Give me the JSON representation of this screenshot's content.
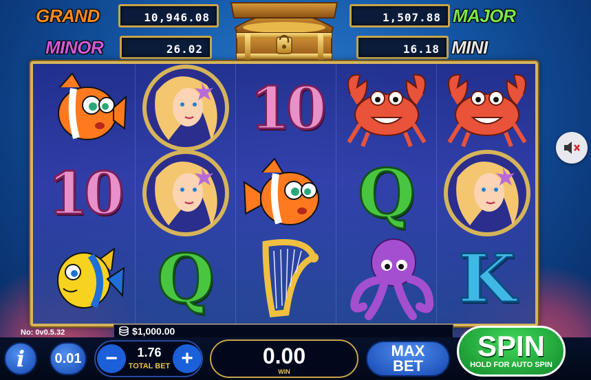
{
  "jackpots": {
    "grand": {
      "label": "GRAND",
      "value": "10,946.08"
    },
    "major": {
      "label": "MAJOR",
      "value": "1,507.88"
    },
    "minor": {
      "label": "MINOR",
      "value": "26.02"
    },
    "mini": {
      "label": "MINI",
      "value": "16.18"
    }
  },
  "reels": {
    "col1": [
      "clownfish",
      "10",
      "yellow-fish"
    ],
    "col2": [
      "mermaid",
      "mermaid",
      "Q"
    ],
    "col3": [
      "10",
      "clownfish",
      "harp"
    ],
    "col4": [
      "crab",
      "Q",
      "octopus"
    ],
    "col5": [
      "crab",
      "mermaid",
      "K"
    ]
  },
  "symbols": {
    "ten": "10",
    "q": "Q",
    "k": "K"
  },
  "footer": {
    "version": "No: 0v0.5.32",
    "balance": "$1,000.00",
    "denomination": "0.01",
    "total_bet_value": "1.76",
    "total_bet_label": "TOTAL BET",
    "minus": "−",
    "plus": "+",
    "win_value": "0.00",
    "win_label": "WIN",
    "max_bet_label_1": "MAX",
    "max_bet_label_2": "BET",
    "spin_label": "SPIN",
    "spin_sub": "HOLD FOR AUTO SPIN",
    "info_label": "i"
  },
  "colors": {
    "grand": "#ff8a1e",
    "major": "#7be84a",
    "minor": "#d35bd8",
    "mini": "#e6e6e6",
    "spin_green": "#1fa83a",
    "blue_button": "#1b5fd9"
  }
}
